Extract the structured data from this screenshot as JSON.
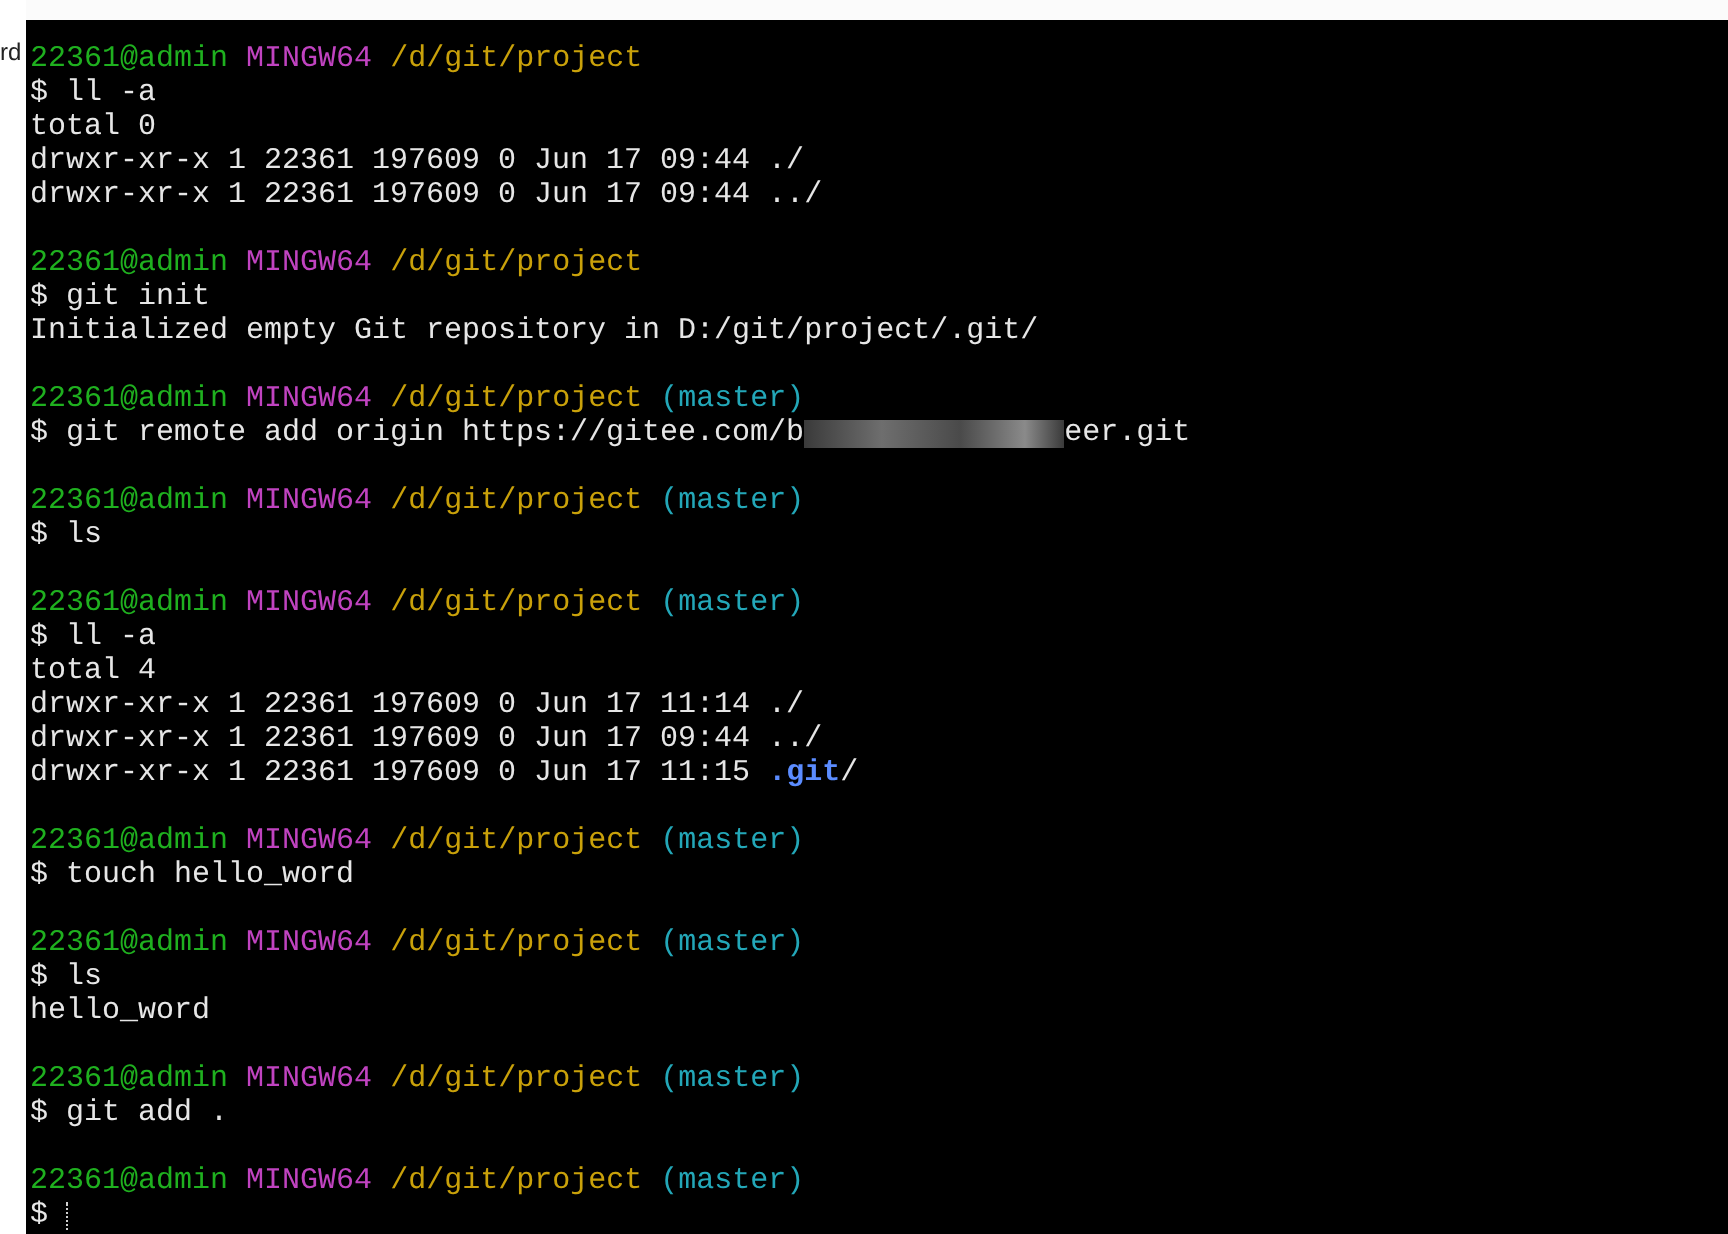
{
  "left_edge_text": "rd",
  "blocks": [
    {
      "prompt": {
        "user_host": "22361@admin",
        "system": "MINGW64",
        "path": "/d/git/project"
      },
      "command": [
        {
          "kind": "text",
          "text": "$ ll -a"
        }
      ],
      "output": [
        [
          {
            "kind": "plain",
            "text": "total 0"
          }
        ],
        [
          {
            "kind": "plain",
            "text": "drwxr-xr-x 1 22361 197609 0 Jun 17 09:44 ./"
          }
        ],
        [
          {
            "kind": "plain",
            "text": "drwxr-xr-x 1 22361 197609 0 Jun 17 09:44 ../"
          }
        ]
      ]
    },
    {
      "prompt": {
        "user_host": "22361@admin",
        "system": "MINGW64",
        "path": "/d/git/project"
      },
      "command": [
        {
          "kind": "text",
          "text": "$ git init"
        }
      ],
      "output": [
        [
          {
            "kind": "plain",
            "text": "Initialized empty Git repository in D:/git/project/.git/"
          }
        ]
      ]
    },
    {
      "prompt": {
        "user_host": "22361@admin",
        "system": "MINGW64",
        "path": "/d/git/project",
        "branch": "(master)"
      },
      "command": [
        {
          "kind": "text",
          "text": "$ git remote add origin https://gitee.com/b"
        },
        {
          "kind": "redacted"
        },
        {
          "kind": "text",
          "text": "eer.git"
        }
      ]
    },
    {
      "prompt": {
        "user_host": "22361@admin",
        "system": "MINGW64",
        "path": "/d/git/project",
        "branch": "(master)"
      },
      "command": [
        {
          "kind": "text",
          "text": "$ ls"
        }
      ]
    },
    {
      "prompt": {
        "user_host": "22361@admin",
        "system": "MINGW64",
        "path": "/d/git/project",
        "branch": "(master)"
      },
      "command": [
        {
          "kind": "text",
          "text": "$ ll -a"
        }
      ],
      "output": [
        [
          {
            "kind": "plain",
            "text": "total 4"
          }
        ],
        [
          {
            "kind": "plain",
            "text": "drwxr-xr-x 1 22361 197609 0 Jun 17 11:14 ./"
          }
        ],
        [
          {
            "kind": "plain",
            "text": "drwxr-xr-x 1 22361 197609 0 Jun 17 09:44 ../"
          }
        ],
        [
          {
            "kind": "plain",
            "text": "drwxr-xr-x 1 22361 197609 0 Jun 17 11:15 "
          },
          {
            "kind": "git-dir",
            "text": ".git"
          },
          {
            "kind": "plain",
            "text": "/"
          }
        ]
      ]
    },
    {
      "prompt": {
        "user_host": "22361@admin",
        "system": "MINGW64",
        "path": "/d/git/project",
        "branch": "(master)"
      },
      "command": [
        {
          "kind": "text",
          "text": "$ touch hello_word"
        }
      ]
    },
    {
      "prompt": {
        "user_host": "22361@admin",
        "system": "MINGW64",
        "path": "/d/git/project",
        "branch": "(master)"
      },
      "command": [
        {
          "kind": "text",
          "text": "$ ls"
        }
      ],
      "output": [
        [
          {
            "kind": "plain",
            "text": "hello_word"
          }
        ]
      ]
    },
    {
      "prompt": {
        "user_host": "22361@admin",
        "system": "MINGW64",
        "path": "/d/git/project",
        "branch": "(master)"
      },
      "command": [
        {
          "kind": "text",
          "text": "$ git add ."
        }
      ]
    },
    {
      "prompt": {
        "user_host": "22361@admin",
        "system": "MINGW64",
        "path": "/d/git/project",
        "branch": "(master)"
      },
      "command": [
        {
          "kind": "text",
          "text": "$"
        }
      ],
      "cursor": true
    }
  ]
}
